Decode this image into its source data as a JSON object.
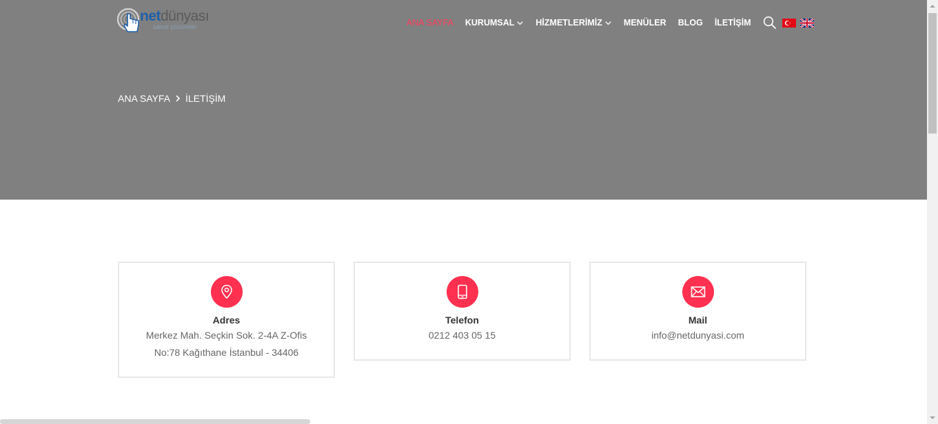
{
  "logo": {
    "net": "net",
    "dunyasi": "dünyası",
    "tagline": "sanal çözümler"
  },
  "nav": {
    "items": [
      {
        "label": "ANA SAYFA",
        "active": true,
        "dropdown": false
      },
      {
        "label": "KURUMSAL",
        "active": false,
        "dropdown": true
      },
      {
        "label": "HİZMETLERİMİZ",
        "active": false,
        "dropdown": true
      },
      {
        "label": "MENÜLER",
        "active": false,
        "dropdown": false
      },
      {
        "label": "BLOG",
        "active": false,
        "dropdown": false
      },
      {
        "label": "İLETİŞİM",
        "active": false,
        "dropdown": false
      }
    ],
    "icons": [
      "search-icon",
      "flag-turkey-icon",
      "flag-uk-icon"
    ]
  },
  "breadcrumb": {
    "home": "ANA SAYFA",
    "current": "İLETİŞİM"
  },
  "contact": {
    "address": {
      "title": "Adres",
      "line1": "Merkez Mah. Seçkin Sok. 2-4A Z-Ofis",
      "line2": "No:78 Kağıthane İstanbul - 34406",
      "icon": "map-pin-icon"
    },
    "phone": {
      "title": "Telefon",
      "line1": "0212 403 05 15",
      "icon": "mobile-phone-icon"
    },
    "mail": {
      "title": "Mail",
      "line1": "info@netdunyasi.com",
      "icon": "envelope-icon"
    }
  },
  "colors": {
    "accent": "#ff3050",
    "hero_bg": "#808080",
    "nav_active": "#ff3b5c"
  }
}
